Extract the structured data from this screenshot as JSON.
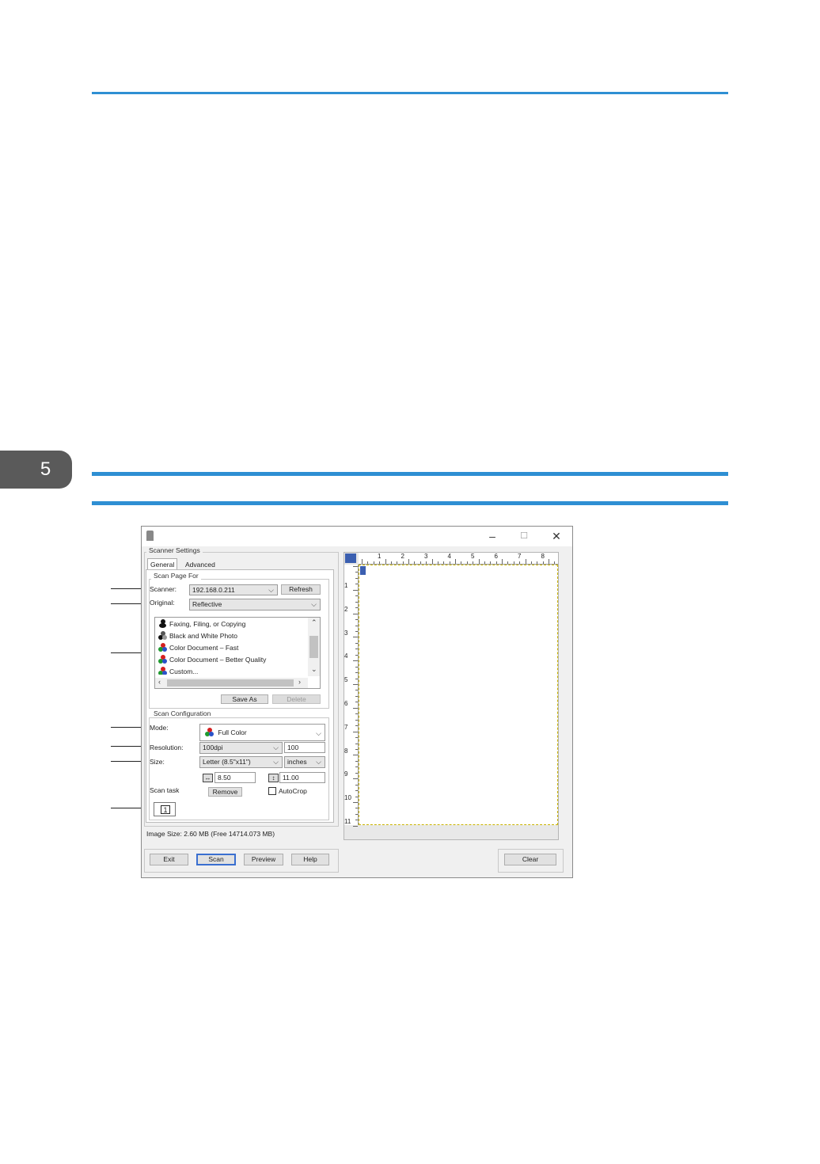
{
  "page": {
    "chapter_number": "5",
    "colors": {
      "rule": "#2e8fd3",
      "chapter_tab": "#5a5a5a"
    }
  },
  "window": {
    "controls": {
      "minimize": "–",
      "maximize": "☐",
      "close": "✕"
    },
    "scanner_settings_title": "Scanner Settings",
    "tabs": {
      "general": "General",
      "advanced": "Advanced"
    },
    "scan_page_for": {
      "title": "Scan Page For",
      "scanner_label": "Scanner:",
      "scanner_value": "192.168.0.211",
      "refresh": "Refresh",
      "original_label": "Original:",
      "original_value": "Reflective",
      "presets": [
        "Faxing, Filing, or Copying",
        "Black and White Photo",
        "Color Document – Fast",
        "Color Document – Better Quality",
        "Custom..."
      ],
      "save_as": "Save As",
      "delete": "Delete"
    },
    "scan_configuration": {
      "title": "Scan Configuration",
      "mode_label": "Mode:",
      "mode_value": "Full Color",
      "resolution_label": "Resolution:",
      "resolution_value": "100dpi",
      "resolution_number": "100",
      "size_label": "Size:",
      "size_value": "Letter (8.5\"x11\")",
      "units_value": "inches",
      "width_value": "8.50",
      "height_value": "11.00",
      "scan_task_label": "Scan task",
      "remove": "Remove",
      "autocrop": "AutoCrop",
      "task_number": "1"
    },
    "image_size": "Image Size: 2.60 MB (Free 14714.073 MB)",
    "buttons": {
      "exit": "Exit",
      "scan": "Scan",
      "preview": "Preview",
      "help": "Help",
      "clear": "Clear"
    },
    "ruler": {
      "h_numbers": [
        "1",
        "2",
        "3",
        "4",
        "5",
        "6",
        "7",
        "8"
      ],
      "v_numbers": [
        "1",
        "2",
        "3",
        "4",
        "5",
        "6",
        "7",
        "8",
        "9",
        "10",
        "11"
      ]
    }
  }
}
